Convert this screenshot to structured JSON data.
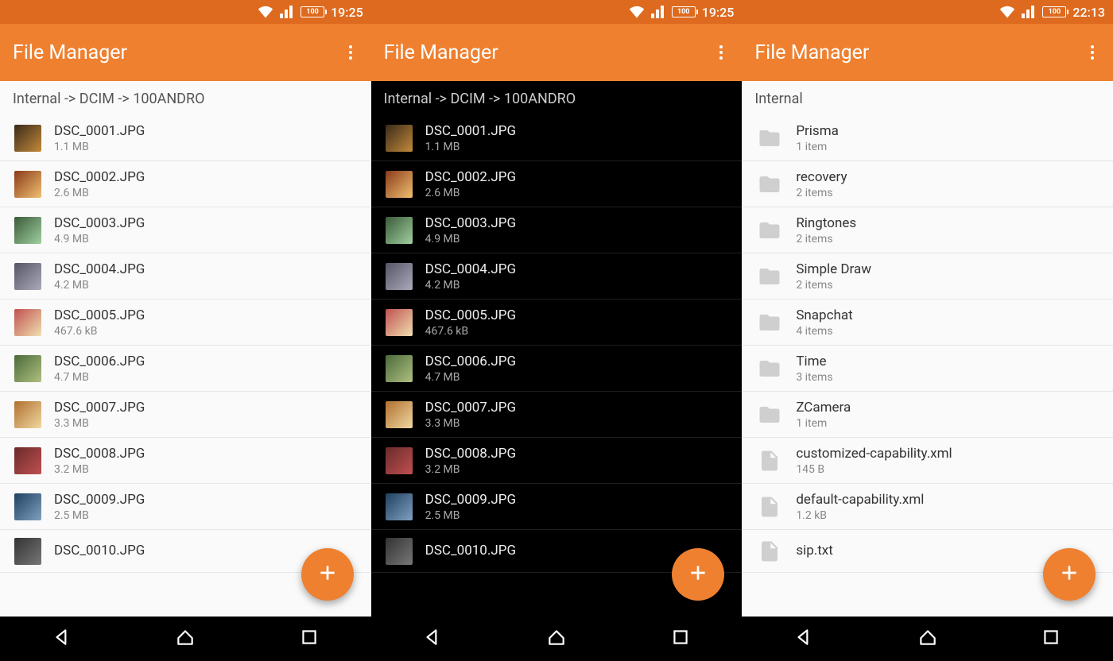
{
  "brand_accent": "#ee8030",
  "status_brand": "#dd6a1f",
  "screens": [
    {
      "theme": "light",
      "clock": "19:25",
      "battery": "100",
      "title": "File Manager",
      "breadcrumb": "Internal -> DCIM -> 100ANDRO",
      "items": [
        {
          "type": "img",
          "thumb": "t1",
          "name": "DSC_0001.JPG",
          "sub": "1.1 MB"
        },
        {
          "type": "img",
          "thumb": "t2",
          "name": "DSC_0002.JPG",
          "sub": "2.6 MB"
        },
        {
          "type": "img",
          "thumb": "t3",
          "name": "DSC_0003.JPG",
          "sub": "4.9 MB"
        },
        {
          "type": "img",
          "thumb": "t4",
          "name": "DSC_0004.JPG",
          "sub": "4.2 MB"
        },
        {
          "type": "img",
          "thumb": "t5",
          "name": "DSC_0005.JPG",
          "sub": "467.6 kB"
        },
        {
          "type": "img",
          "thumb": "t6",
          "name": "DSC_0006.JPG",
          "sub": "4.7 MB"
        },
        {
          "type": "img",
          "thumb": "t7",
          "name": "DSC_0007.JPG",
          "sub": "3.3 MB"
        },
        {
          "type": "img",
          "thumb": "t8",
          "name": "DSC_0008.JPG",
          "sub": "3.2 MB"
        },
        {
          "type": "img",
          "thumb": "t9",
          "name": "DSC_0009.JPG",
          "sub": "2.5 MB"
        },
        {
          "type": "img",
          "thumb": "t10",
          "name": "DSC_0010.JPG",
          "sub": ""
        }
      ]
    },
    {
      "theme": "dark",
      "clock": "19:25",
      "battery": "100",
      "title": "File Manager",
      "breadcrumb": "Internal -> DCIM -> 100ANDRO",
      "items": [
        {
          "type": "img",
          "thumb": "t1",
          "name": "DSC_0001.JPG",
          "sub": "1.1 MB"
        },
        {
          "type": "img",
          "thumb": "t2",
          "name": "DSC_0002.JPG",
          "sub": "2.6 MB"
        },
        {
          "type": "img",
          "thumb": "t3",
          "name": "DSC_0003.JPG",
          "sub": "4.9 MB"
        },
        {
          "type": "img",
          "thumb": "t4",
          "name": "DSC_0004.JPG",
          "sub": "4.2 MB"
        },
        {
          "type": "img",
          "thumb": "t5",
          "name": "DSC_0005.JPG",
          "sub": "467.6 kB"
        },
        {
          "type": "img",
          "thumb": "t6",
          "name": "DSC_0006.JPG",
          "sub": "4.7 MB"
        },
        {
          "type": "img",
          "thumb": "t7",
          "name": "DSC_0007.JPG",
          "sub": "3.3 MB"
        },
        {
          "type": "img",
          "thumb": "t8",
          "name": "DSC_0008.JPG",
          "sub": "3.2 MB"
        },
        {
          "type": "img",
          "thumb": "t9",
          "name": "DSC_0009.JPG",
          "sub": "2.5 MB"
        },
        {
          "type": "img",
          "thumb": "t10",
          "name": "DSC_0010.JPG",
          "sub": ""
        }
      ]
    },
    {
      "theme": "light",
      "clock": "22:13",
      "battery": "100",
      "title": "File Manager",
      "breadcrumb": "Internal",
      "items": [
        {
          "type": "folder",
          "name": "Prisma",
          "sub": "1 item"
        },
        {
          "type": "folder",
          "name": "recovery",
          "sub": "2 items"
        },
        {
          "type": "folder",
          "name": "Ringtones",
          "sub": "2 items"
        },
        {
          "type": "folder",
          "name": "Simple Draw",
          "sub": "2 items"
        },
        {
          "type": "folder",
          "name": "Snapchat",
          "sub": "4 items"
        },
        {
          "type": "folder",
          "name": "Time",
          "sub": "3 items"
        },
        {
          "type": "folder",
          "name": "ZCamera",
          "sub": "1 item"
        },
        {
          "type": "file",
          "name": "customized-capability.xml",
          "sub": "145 B"
        },
        {
          "type": "file",
          "name": "default-capability.xml",
          "sub": "1.2 kB"
        },
        {
          "type": "file",
          "name": "sip.txt",
          "sub": ""
        }
      ]
    }
  ]
}
